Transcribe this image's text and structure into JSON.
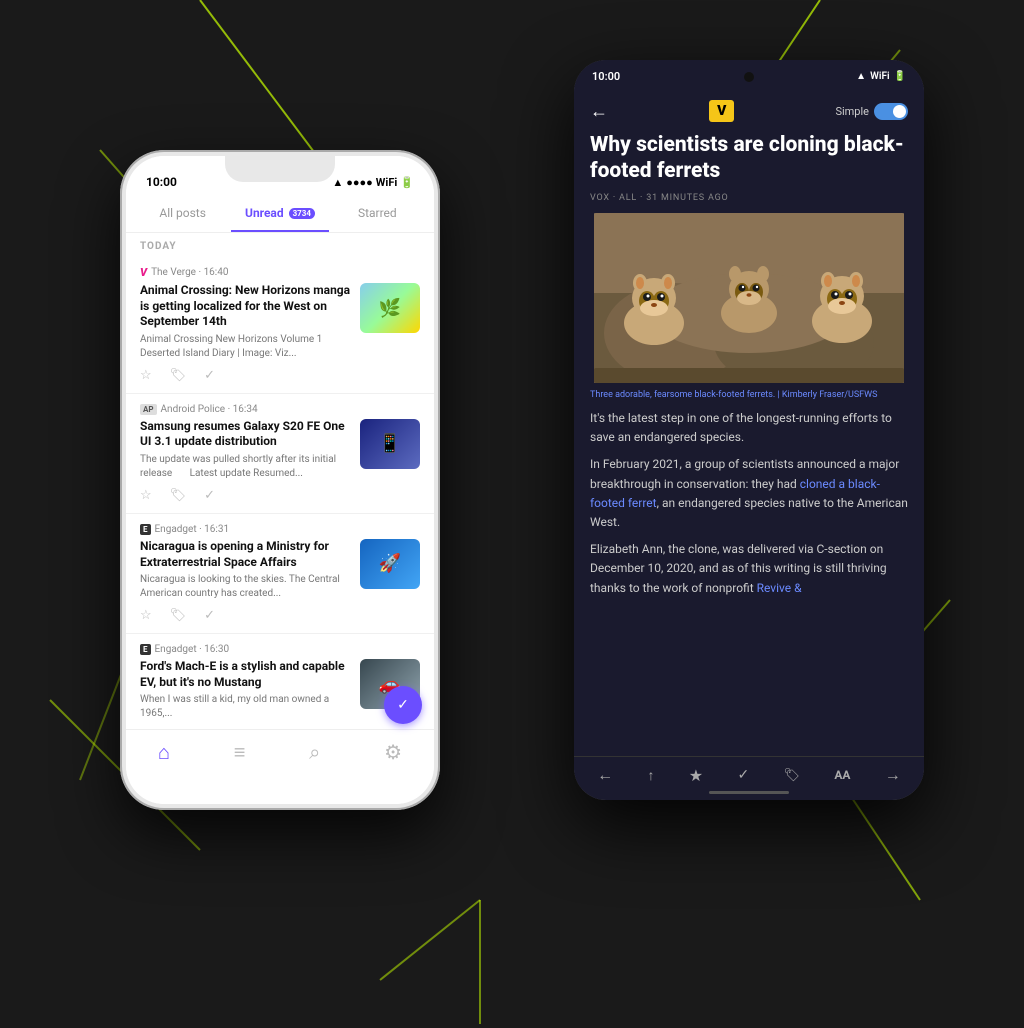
{
  "background": "#1a1a1a",
  "iphone": {
    "status_time": "10:00",
    "tabs": [
      {
        "label": "All posts",
        "active": false
      },
      {
        "label": "Unread",
        "active": true,
        "badge": "3734"
      },
      {
        "label": "Starred",
        "active": false
      }
    ],
    "section_label": "TODAY",
    "articles": [
      {
        "source": "The Verge",
        "source_type": "verge",
        "time": "16:40",
        "title": "Animal Crossing: New Horizons manga is getting localized for the West on September 14th",
        "excerpt": "Animal Crossing New Horizons Volume 1 Deserted Island Diary | Image: Viz...",
        "has_thumb": true,
        "thumb_type": "animal-crossing"
      },
      {
        "source": "Android Police",
        "source_type": "ap",
        "time": "16:34",
        "title": "Samsung resumes Galaxy S20 FE One UI 3.1 update distribution",
        "excerpt": "The update was pulled shortly after its initial release      Latest update Resumed...",
        "has_thumb": true,
        "thumb_type": "samsung"
      },
      {
        "source": "Engadget",
        "source_type": "engadget",
        "time": "16:31",
        "title": "Nicaragua is opening a Ministry for Extraterrestrial Space Affairs",
        "excerpt": "Nicaragua is looking to the skies. The Central American country has created...",
        "has_thumb": true,
        "thumb_type": "nicaragua"
      },
      {
        "source": "Engadget",
        "source_type": "engadget",
        "time": "16:30",
        "title": "Ford's Mach-E is a stylish and capable EV, but it's no Mustang",
        "excerpt": "When I was still a kid, my old man owned a 1965,...",
        "has_thumb": true,
        "thumb_type": "ford"
      }
    ],
    "nav_items": [
      "home",
      "list",
      "search",
      "settings"
    ]
  },
  "android": {
    "status_time": "10:00",
    "back_arrow": "←",
    "logo": "V",
    "simple_label": "Simple",
    "article": {
      "title": "Why scientists are cloning black-footed ferrets",
      "meta": "VOX · ALL · 31 MINUTES AGO",
      "image_caption": "Three adorable, fearsome black-footed ferrets.  |  Kimberly Fraser/USFWS",
      "body_para1": "It's the latest step in one of the longest-running efforts to save an endangered species.",
      "body_para2": "In February 2021, a group of scientists announced a major breakthrough in conservation: they had cloned a black-footed ferret, an endangered species native to the American West.",
      "body_para3": "Elizabeth Ann, the clone, was delivered via C-section on December 10, 2020, and as of this writing is still thriving thanks to the work of nonprofit Revive &",
      "link_text": "cloned a black-footed ferret"
    },
    "bottom_nav_icons": [
      "←",
      "share",
      "★",
      "✓",
      "🏷",
      "AA",
      "→"
    ]
  }
}
